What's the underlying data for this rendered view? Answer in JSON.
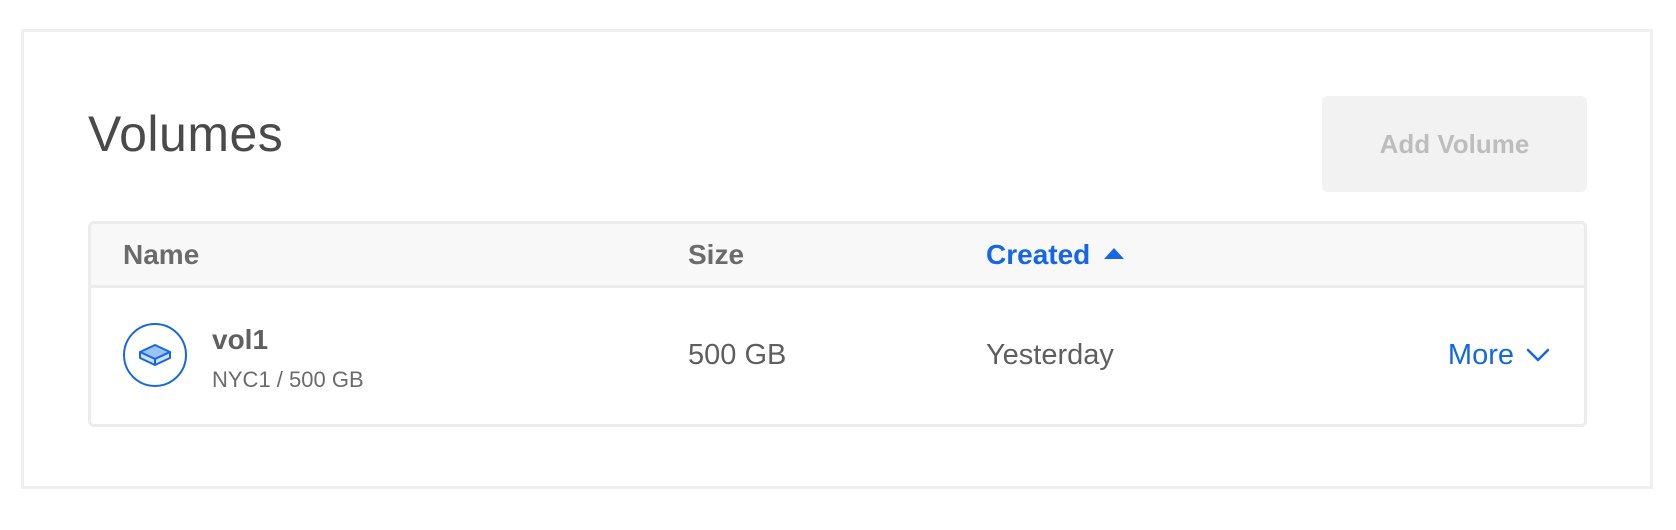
{
  "page": {
    "title": "Volumes",
    "add_button_label": "Add Volume"
  },
  "table": {
    "columns": {
      "name": "Name",
      "size": "Size",
      "created": "Created"
    },
    "sort": {
      "column": "created",
      "direction": "ascending",
      "icon": "sort-up-icon"
    },
    "rows": [
      {
        "name": "vol1",
        "meta": "NYC1 / 500 GB",
        "size": "500 GB",
        "created": "Yesterday",
        "action_label": "More",
        "icon": "volume-icon"
      }
    ]
  },
  "colors": {
    "accent": "#1567e6",
    "text": "#4a4a4a",
    "muted": "#6b6b6b",
    "disabled_button_bg": "#f2f2f2",
    "disabled_button_text": "#bdbdbd"
  }
}
